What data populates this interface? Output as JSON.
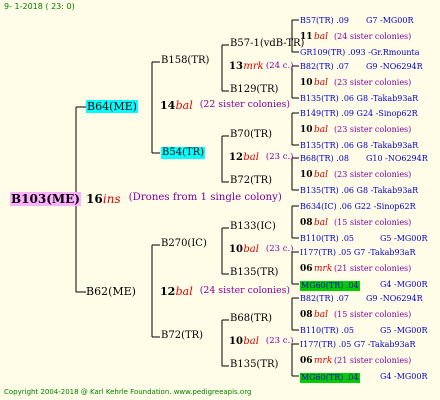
{
  "colors": {
    "background": "#fffce8",
    "cyan_highlight": "#00ffff",
    "green_highlight": "#00cc00",
    "line": "#000000",
    "blue": "#0000cc",
    "purple": "#8000a0",
    "red": "#dd0000",
    "green": "#008000"
  },
  "header": "9-  1-2018 ( 23:  0)",
  "footer": "Copyright 2004-2018 @ Karl Kehrle Foundation.   www.pedigreeapis.org",
  "root": {
    "label": "B103(ME)",
    "num": "16",
    "tag": "ins",
    "note": "(Drones from 1 single colony)"
  },
  "gen1": {
    "top": {
      "label": "B64(ME)",
      "num": "14",
      "tag": "bal",
      "note": "(22 sister colonies)"
    },
    "bottom": {
      "label": "B62(ME)",
      "num": "12",
      "tag": "bal",
      "note": "(24 sister colonies)"
    }
  },
  "gen2": [
    {
      "label": "B158(TR)",
      "num": "13",
      "tag": "mrk",
      "note": "(24 c.)"
    },
    {
      "label": "B54(TR)",
      "num": "12",
      "tag": "bal",
      "note": "(23 c.)"
    },
    {
      "label": "B270(IC)",
      "num": "10",
      "tag": "bal",
      "note": "(23 c.)"
    },
    {
      "label": "B72(TR)",
      "num": "10",
      "tag": "bal",
      "note": "(23 c.)"
    }
  ],
  "gen3": [
    {
      "label": "B57-1(vdB-TR)"
    },
    {
      "label": "B129(TR)"
    },
    {
      "label": "B70(TR)"
    },
    {
      "label": "B72(TR)"
    },
    {
      "label": "B133(IC)"
    },
    {
      "label": "B135(TR)"
    },
    {
      "label": "B68(TR)"
    },
    {
      "label": "B135(TR)"
    }
  ],
  "gen4": [
    {
      "rows": [
        "B57(TR) .09",
        "11 bal (24 sister colonies)",
        "GR109(TR) .093 -Gr.Rmounta"
      ],
      "right_top": "G7 -MG00R"
    },
    {
      "rows": [
        "B82(TR) .07",
        "10 bal (23 sister colonies)",
        "B135(TR) .06 G8 -Takab93aR"
      ],
      "right_top": "G9 -NO6294R"
    },
    {
      "rows": [
        "B149(TR) .09 G24 -Sinop62R",
        "10 bal (23 sister colonies)",
        "B135(TR) .06 G8 -Takab93aR"
      ]
    },
    {
      "rows": [
        "B68(TR) .08",
        "10 bal (23 sister colonies)",
        "B135(TR) .06 G8 -Takab93aR"
      ],
      "right_top": "G10 -NO6294R"
    },
    {
      "rows": [
        "B634(IC) .06  G22 -Sinop62R",
        "08 bal (15 sister colonies)",
        "B110(TR) .05"
      ],
      "right_bottom": "G5 -MG00R"
    },
    {
      "rows": [
        "I177(TR) .05  G7 -Takab93aR",
        "06 mrk (21 sister colonies)",
        "MG60(TR) .04"
      ],
      "right_bottom": "G4 -MG00R"
    },
    {
      "rows": [
        "B82(TR) .07",
        "08 bal (15 sister colonies)",
        "B110(TR) .05"
      ],
      "right_top": "G9 -NO6294R",
      "right_bottom": "G5 -MG00R"
    },
    {
      "rows": [
        "I177(TR) .05  G7 -Takab93aR",
        "06 mrk (21 sister colonies)",
        "MG60(TR) .04"
      ],
      "right_bottom": "G4 -MG00R"
    }
  ]
}
